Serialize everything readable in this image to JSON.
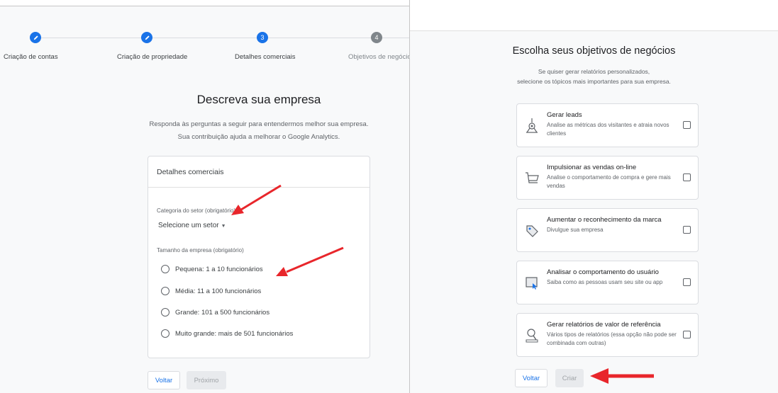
{
  "left": {
    "steps": [
      {
        "label": "Criação de contas",
        "state": "done"
      },
      {
        "label": "Criação de propriedade",
        "state": "done"
      },
      {
        "label": "Detalhes comerciais",
        "state": "current",
        "number": "3"
      },
      {
        "label": "Objetivos de negócios",
        "state": "upcoming",
        "number": "4"
      }
    ],
    "title": "Descreva sua empresa",
    "subtitle_line1": "Responda às perguntas a seguir para entendermos melhor sua empresa.",
    "subtitle_line2": "Sua contribuição ajuda a melhorar o Google Analytics.",
    "card": {
      "header": "Detalhes comerciais",
      "sector_label": "Categoria do setor (obrigatório)",
      "sector_value": "Selecione um setor",
      "size_label": "Tamanho da empresa (obrigatório)",
      "size_options": [
        {
          "bold": "Pequena:",
          "rest": " 1 a 10 funcionários"
        },
        {
          "bold": "Média:",
          "rest": " 11 a 100 funcionários"
        },
        {
          "bold": "Grande:",
          "rest": " 101 a 500 funcionários"
        },
        {
          "bold": "Muito grande:",
          "rest": " mais de 501 funcionários"
        }
      ]
    },
    "back_label": "Voltar",
    "next_label": "Próximo"
  },
  "right": {
    "title": "Escolha seus objetivos de negócios",
    "subtitle_line1": "Se quiser gerar relatórios personalizados,",
    "subtitle_line2": "selecione os tópicos mais importantes para sua empresa.",
    "objectives": [
      {
        "icon": "leads-target-icon",
        "title": "Gerar leads",
        "desc": "Analise as métricas dos visitantes e atraia novos clientes"
      },
      {
        "icon": "shopping-cart-icon",
        "title": "Impulsionar as vendas on-line",
        "desc": "Analise o comportamento de compra e gere mais vendas"
      },
      {
        "icon": "brand-tag-icon",
        "title": "Aumentar o reconhecimento da marca",
        "desc": "Divulgue sua empresa"
      },
      {
        "icon": "user-behavior-icon",
        "title": "Analisar o comportamento do usuário",
        "desc": "Saiba como as pessoas usam seu site ou app"
      },
      {
        "icon": "benchmark-report-icon",
        "title": "Gerar relatórios de valor de referência",
        "desc": "Vários tipos de relatórios (essa opção não pode ser combinada com outras)"
      }
    ],
    "back_label": "Voltar",
    "create_label": "Criar"
  },
  "colors": {
    "accent": "#1a73e8",
    "arrow": "#e8262b",
    "muted": "#80868b"
  }
}
